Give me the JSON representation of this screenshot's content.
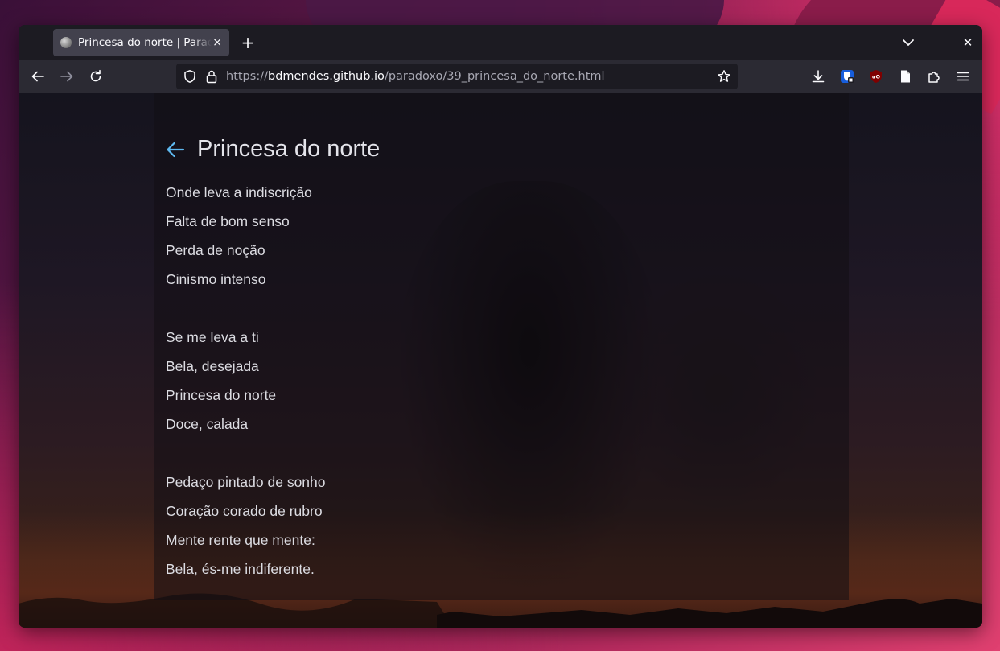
{
  "browser": {
    "tab": {
      "title": "Princesa do norte | Paradoxo",
      "favicon": "moon-favicon-icon",
      "close": "×"
    },
    "new_tab": "+",
    "window_close": "✕",
    "url": {
      "scheme": "https://",
      "host": "bdmendes.github.io",
      "path": "/paradoxo/39_princesa_do_norte.html"
    },
    "icons": [
      "back-icon",
      "forward-icon",
      "reload-icon",
      "shield-icon",
      "lock-icon",
      "bookmark-star-icon",
      "download-icon",
      "bitwarden-extension-icon",
      "ublock-extension-icon",
      "reader-icon",
      "extensions-icon",
      "menu-icon"
    ],
    "accent": "#5eb8ef"
  },
  "page": {
    "title": "Princesa do norte",
    "stanzas": [
      [
        "Onde leva a indiscrição",
        "Falta de bom senso",
        "Perda de noção",
        "Cinismo intenso"
      ],
      [
        "Se me leva a ti",
        "Bela, desejada",
        "Princesa do norte",
        "Doce, calada"
      ],
      [
        "Pedaço pintado de sonho",
        "Coração corado de rubro",
        "Mente rente que mente:",
        "Bela, és-me indiferente."
      ]
    ]
  }
}
